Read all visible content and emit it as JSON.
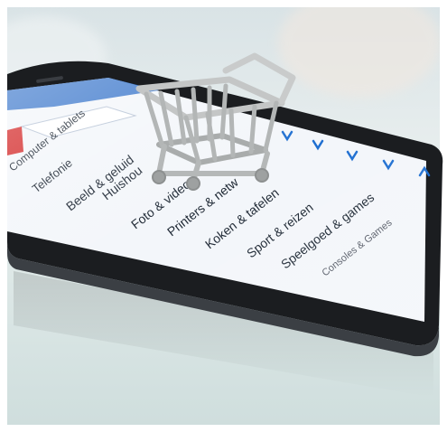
{
  "menu": {
    "items": [
      "Computer & tablets",
      "Telefonie",
      "Beeld & geluid",
      "Huishou",
      "Foto & video",
      "Printers & netw",
      "Koken & tafelen",
      "Sport & reizen",
      "Speelgoed & games",
      "Consoles & Games"
    ]
  },
  "colors": {
    "accent_red": "#d42b2b",
    "chevron_blue": "#1f6fd1",
    "screen_bg": "#f3f6fa",
    "phone_body": "#1b1d20"
  },
  "icons": [
    "shopping-cart-icon",
    "chevron-down-icon",
    "chevron-up-icon"
  ]
}
